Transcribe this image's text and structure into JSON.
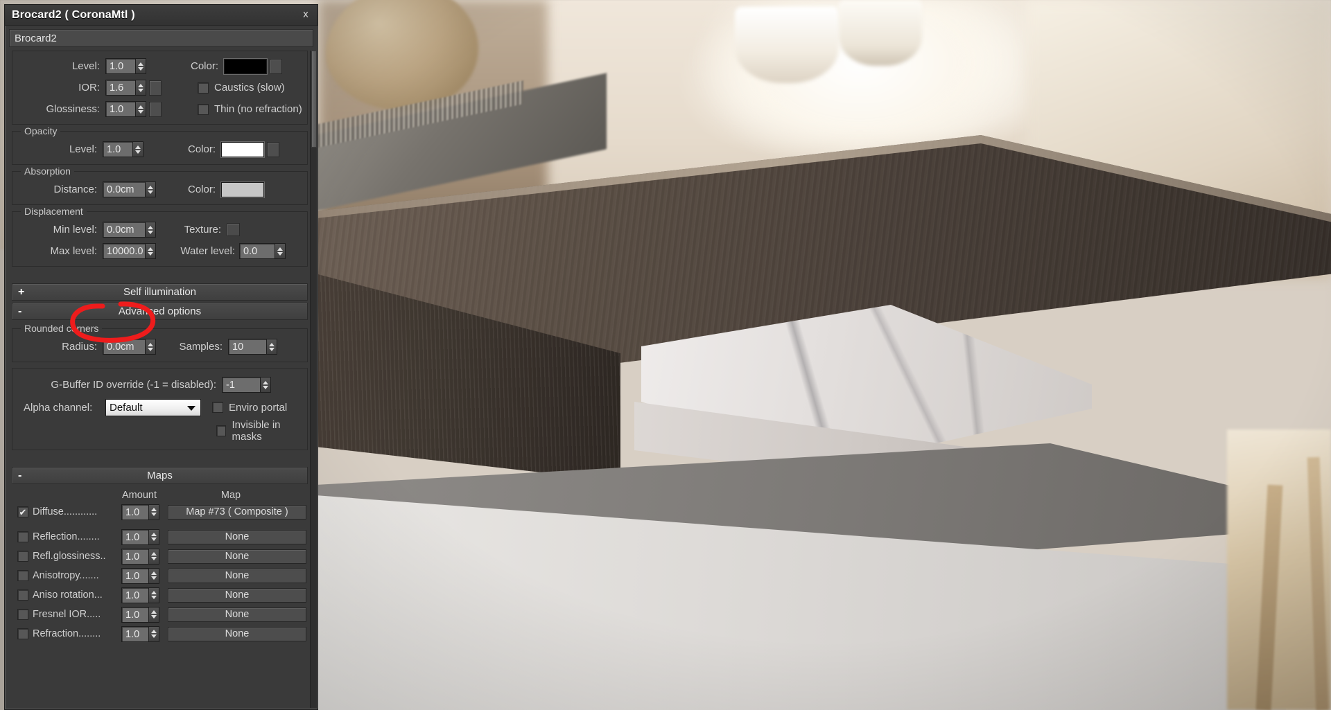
{
  "window": {
    "title": "Brocard2  ( CoronaMtl )",
    "close_label": "x",
    "material_name": "Brocard2"
  },
  "refraction_group": {
    "level_label": "Level:",
    "level_value": "1.0",
    "color_label": "Color:",
    "color_value": "#000000",
    "ior_label": "IOR:",
    "ior_value": "1.6",
    "glossiness_label": "Glossiness:",
    "glossiness_value": "1.0",
    "caustics_label": "Caustics (slow)",
    "caustics_checked": false,
    "thin_label": "Thin (no refraction)",
    "thin_checked": false
  },
  "opacity_group": {
    "title": "Opacity",
    "level_label": "Level:",
    "level_value": "1.0",
    "color_label": "Color:",
    "color_value": "#ffffff"
  },
  "absorption_group": {
    "title": "Absorption",
    "distance_label": "Distance:",
    "distance_value": "0.0cm",
    "color_label": "Color:",
    "color_value": "#c6c6c6"
  },
  "displacement_group": {
    "title": "Displacement",
    "min_level_label": "Min level:",
    "min_level_value": "0.0cm",
    "texture_label": "Texture:",
    "max_level_label": "Max level:",
    "max_level_value": "10000.0",
    "water_level_label": "Water level:",
    "water_level_value": "0.0"
  },
  "rollouts": {
    "self_illumination": {
      "sign": "+",
      "title": "Self illumination"
    },
    "advanced_options": {
      "sign": "-",
      "title": "Advanced options"
    },
    "maps": {
      "sign": "-",
      "title": "Maps"
    }
  },
  "advanced": {
    "rounded_corners_title": "Rounded corners",
    "radius_label": "Radius:",
    "radius_value": "0.0cm",
    "samples_label": "Samples:",
    "samples_value": "10",
    "gbuffer_label": "G-Buffer ID override (-1 = disabled):",
    "gbuffer_value": "-1",
    "alpha_channel_label": "Alpha channel:",
    "alpha_channel_value": "Default",
    "enviro_portal_label": "Enviro portal",
    "enviro_portal_checked": false,
    "invisible_in_masks_label": "Invisible in masks",
    "invisible_in_masks_checked": false
  },
  "maps": {
    "amount_header": "Amount",
    "map_header": "Map",
    "rows": [
      {
        "name": "Diffuse............",
        "checked": true,
        "amount": "1.0",
        "map": "Map #73  ( Composite )"
      },
      {
        "name": "Reflection........",
        "checked": false,
        "amount": "1.0",
        "map": "None"
      },
      {
        "name": "Refl.glossiness..",
        "checked": false,
        "amount": "1.0",
        "map": "None"
      },
      {
        "name": "Anisotropy.......",
        "checked": false,
        "amount": "1.0",
        "map": "None"
      },
      {
        "name": "Aniso rotation...",
        "checked": false,
        "amount": "1.0",
        "map": "None"
      },
      {
        "name": "Fresnel IOR.....",
        "checked": false,
        "amount": "1.0",
        "map": "None"
      },
      {
        "name": "Refraction........",
        "checked": false,
        "amount": "1.0",
        "map": "None"
      }
    ]
  },
  "annotation": {
    "shape": "red-ellipse",
    "color": "#ee1c1c",
    "target": "Radius field"
  }
}
